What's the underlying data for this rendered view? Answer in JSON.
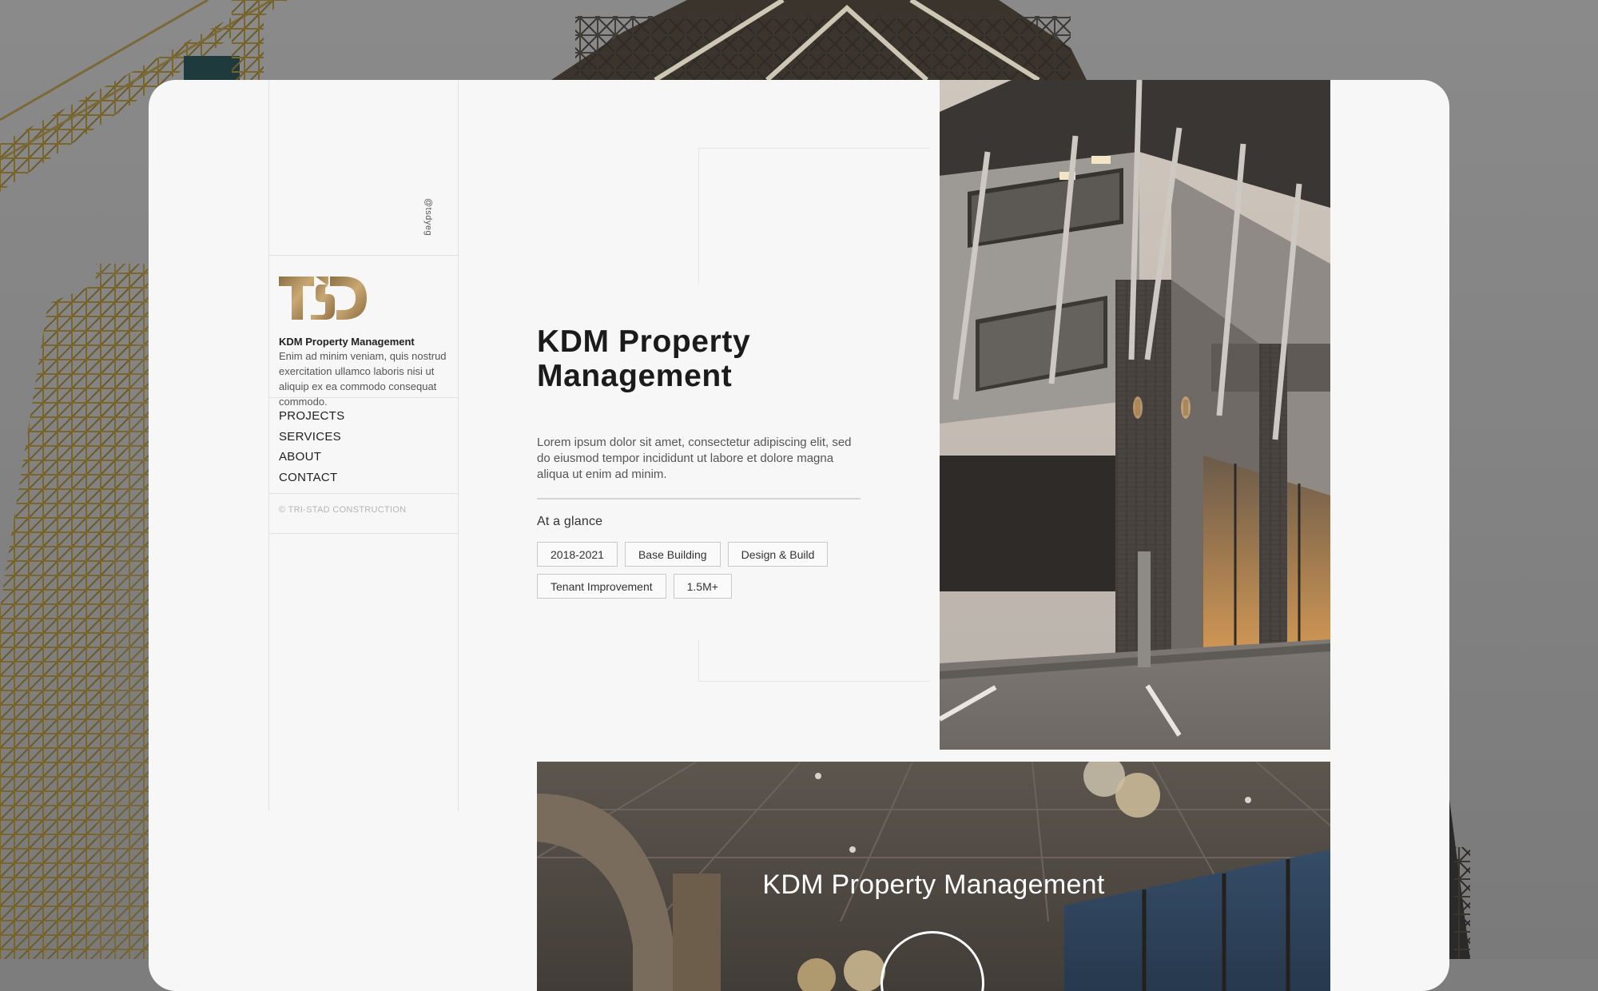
{
  "sidebar": {
    "handle": "@tsdyeg",
    "logo": {
      "icon": "tsd-logo",
      "color": "#a8875a"
    },
    "brand_name": "KDM Property Management",
    "brand_desc": "Enim ad minim veniam, quis nostrud exercitation ullamco laboris nisi ut aliquip ex ea commodo consequat commodo.",
    "nav": [
      {
        "label": "PROJECTS"
      },
      {
        "label": "SERVICES"
      },
      {
        "label": "ABOUT"
      },
      {
        "label": "CONTACT"
      }
    ],
    "copyright": "© TRI-STAD CONSTRUCTION"
  },
  "main": {
    "title": "KDM Property Management",
    "lead": "Lorem ipsum dolor sit amet, consectetur adipiscing elit, sed do eiusmod tempor incididunt ut labore et dolore magna aliqua ut enim ad minim.",
    "glance_label": "At a glance",
    "tags": [
      "2018-2021",
      "Base Building",
      "Design & Build",
      "Tenant Improvement",
      "1.5M+"
    ]
  },
  "video": {
    "title": "KDM Property Management",
    "play_icon": "play-icon"
  }
}
